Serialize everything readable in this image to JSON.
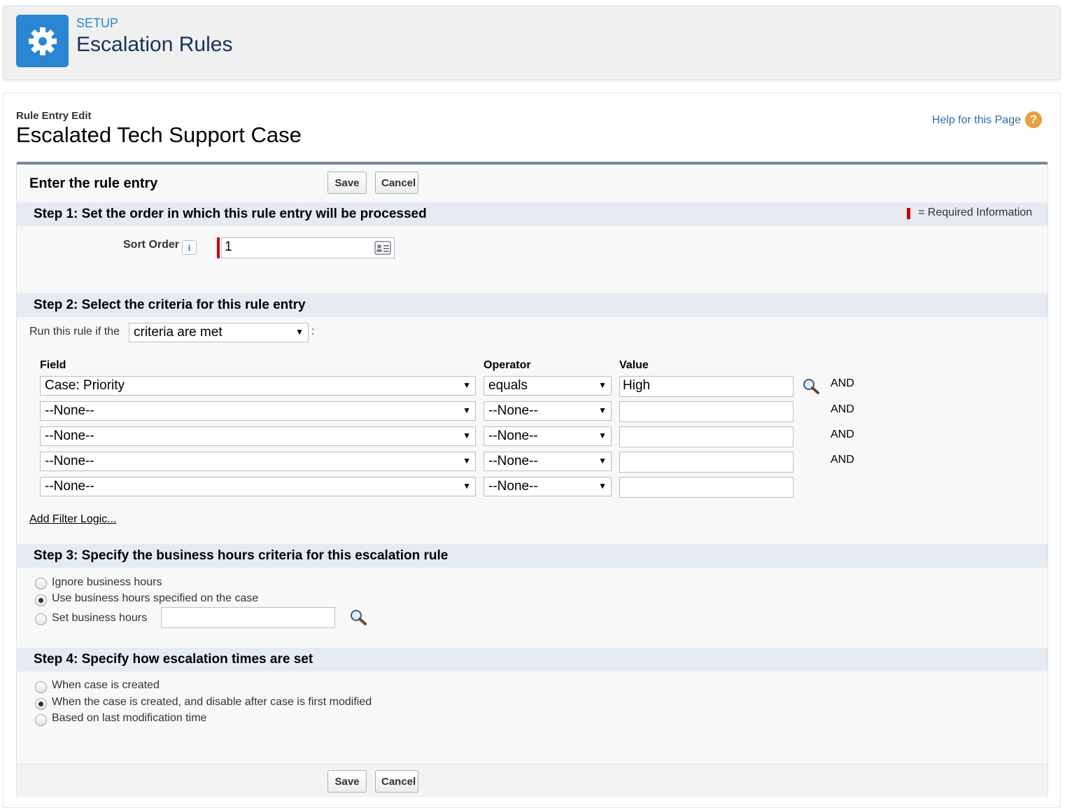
{
  "header": {
    "section_label": "SETUP",
    "title": "Escalation Rules"
  },
  "page": {
    "entry_type": "Rule Entry Edit",
    "entry_name": "Escalated Tech Support Case",
    "help_link": "Help for this Page",
    "help_icon_glyph": "?"
  },
  "form": {
    "block_title": "Enter the rule entry",
    "save_label": "Save",
    "cancel_label": "Cancel",
    "required_text": "= Required Information"
  },
  "step1": {
    "title": "Step 1: Set the order in which this rule entry will be processed",
    "sort_order_label": "Sort Order",
    "info_glyph": "i",
    "sort_order_value": "1"
  },
  "step2": {
    "title": "Step 2: Select the criteria for this rule entry",
    "run_rule_prefix": "Run this rule if the",
    "run_rule_selected": "criteria are met",
    "run_rule_suffix": ":",
    "columns": {
      "field": "Field",
      "operator": "Operator",
      "value": "Value"
    },
    "rows": [
      {
        "field": "Case: Priority",
        "operator": "equals",
        "value": "High",
        "conjunction": "AND"
      },
      {
        "field": "--None--",
        "operator": "--None--",
        "value": "",
        "conjunction": "AND"
      },
      {
        "field": "--None--",
        "operator": "--None--",
        "value": "",
        "conjunction": "AND"
      },
      {
        "field": "--None--",
        "operator": "--None--",
        "value": "",
        "conjunction": "AND"
      },
      {
        "field": "--None--",
        "operator": "--None--",
        "value": "",
        "conjunction": ""
      }
    ],
    "add_filter_logic": "Add Filter Logic..."
  },
  "step3": {
    "title": "Step 3: Specify the business hours criteria for this escalation rule",
    "options": [
      {
        "label": "Ignore business hours",
        "checked": false
      },
      {
        "label": "Use business hours specified on the case",
        "checked": true
      },
      {
        "label": "Set business hours",
        "checked": false
      }
    ],
    "business_hours_value": ""
  },
  "step4": {
    "title": "Step 4: Specify how escalation times are set",
    "options": [
      {
        "label": "When case is created",
        "checked": false
      },
      {
        "label": "When the case is created, and disable after case is first modified",
        "checked": true
      },
      {
        "label": "Based on last modification time",
        "checked": false
      }
    ]
  },
  "icons": {
    "gear": "gear-icon",
    "lookup": "magnifier-icon",
    "help": "help-icon",
    "info": "info-icon",
    "contact_card": "contact-card-icon"
  },
  "colors": {
    "brand_blue": "#2a86d3",
    "required_red": "#cc0000",
    "help_orange": "#e9a03a"
  }
}
